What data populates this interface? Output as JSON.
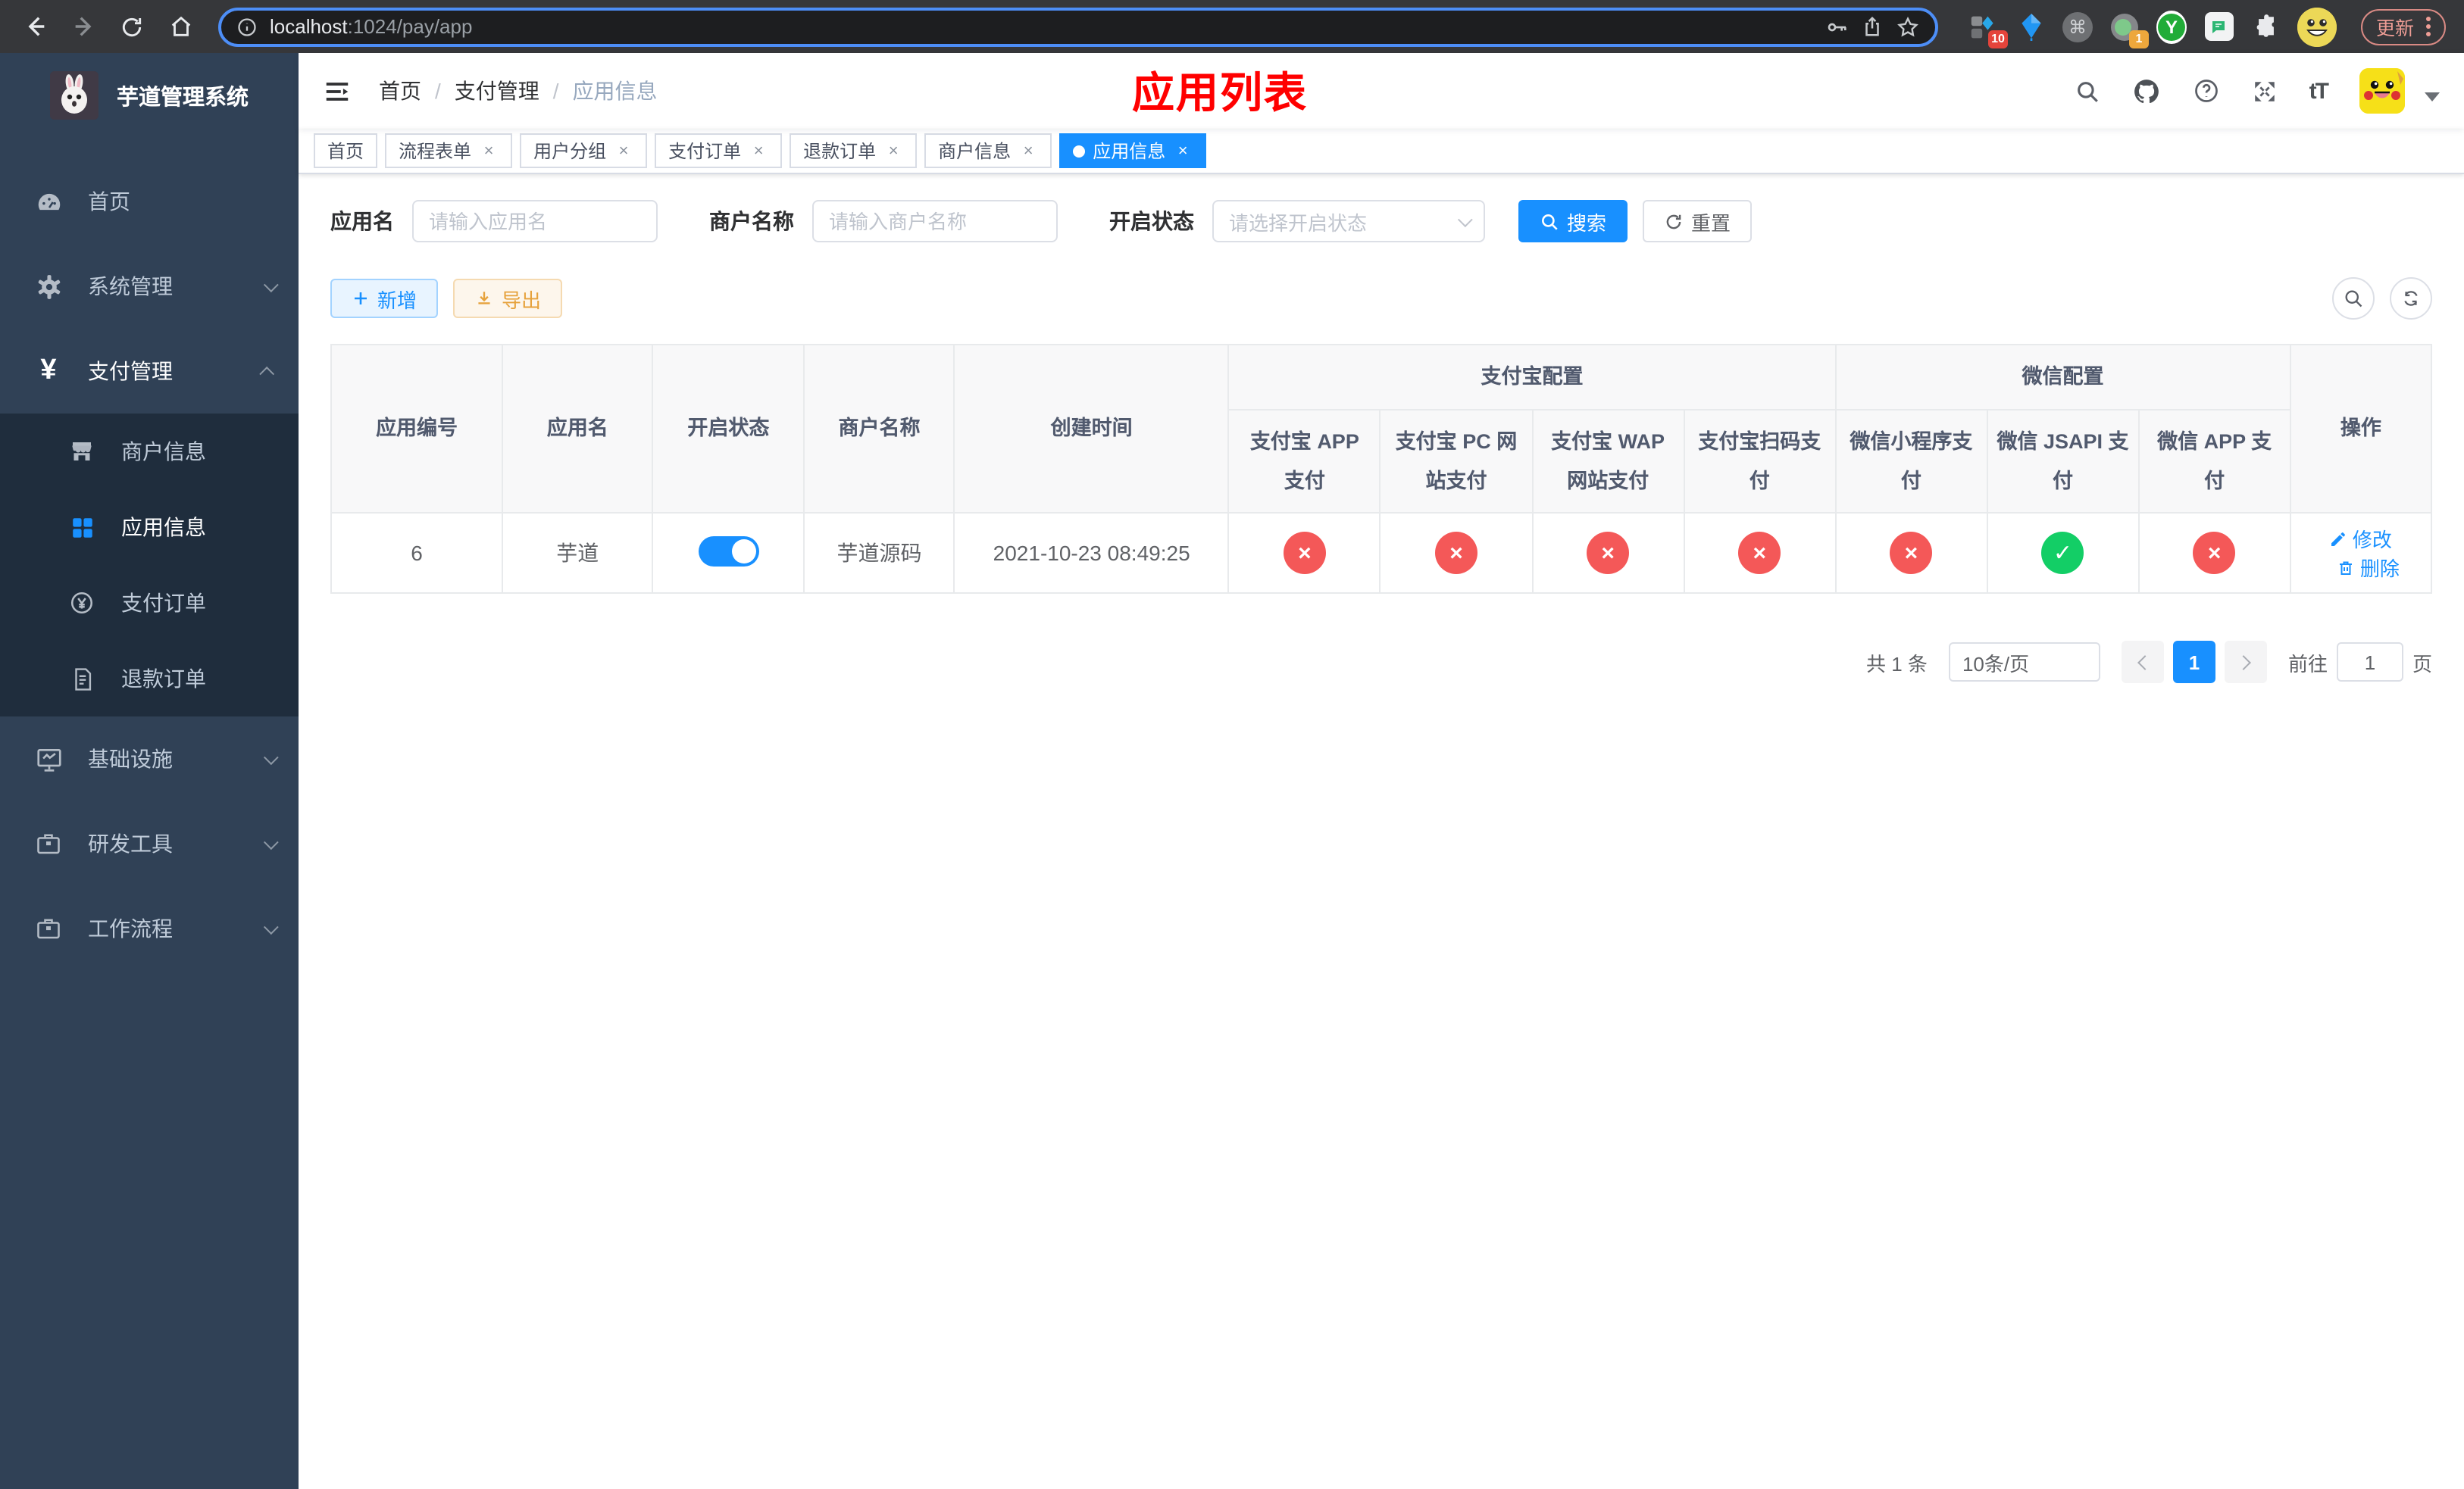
{
  "browser": {
    "url_host": "localhost",
    "url_path": ":1024/pay/app",
    "update_label": "更新",
    "ext_badge_pin": "10",
    "ext_badge_tag": "1",
    "ext_y_label": "Y"
  },
  "glyphs": {
    "yen": "¥",
    "check": "✓",
    "cross": "×",
    "question": "?",
    "command": "⌘",
    "font_size": "tT",
    "close": "×"
  },
  "sidebar": {
    "logo_title": "芋道管理系统",
    "items": [
      {
        "label": "首页",
        "icon": "dashboard"
      },
      {
        "label": "系统管理",
        "icon": "gear"
      },
      {
        "label": "支付管理",
        "icon": "yen"
      }
    ],
    "submenu": [
      {
        "label": "商户信息",
        "icon": "storefront"
      },
      {
        "label": "应用信息",
        "icon": "grid"
      },
      {
        "label": "支付订单",
        "icon": "pay-order"
      },
      {
        "label": "退款订单",
        "icon": "refund-doc"
      }
    ],
    "items_bottom": [
      {
        "label": "基础设施",
        "icon": "monitor-chart"
      },
      {
        "label": "研发工具",
        "icon": "briefcase"
      },
      {
        "label": "工作流程",
        "icon": "briefcase"
      }
    ]
  },
  "header": {
    "breadcrumb": [
      "首页",
      "支付管理",
      "应用信息"
    ],
    "separator": "/",
    "title": "应用列表"
  },
  "tabs": {
    "items": [
      {
        "label": "首页",
        "closable": false,
        "active": false
      },
      {
        "label": "流程表单",
        "closable": true,
        "active": false
      },
      {
        "label": "用户分组",
        "closable": true,
        "active": false
      },
      {
        "label": "支付订单",
        "closable": true,
        "active": false
      },
      {
        "label": "退款订单",
        "closable": true,
        "active": false
      },
      {
        "label": "商户信息",
        "closable": true,
        "active": false
      },
      {
        "label": "应用信息",
        "closable": true,
        "active": true
      }
    ]
  },
  "filters": {
    "app_name_label": "应用名",
    "app_name_placeholder": "请输入应用名",
    "merchant_label": "商户名称",
    "merchant_placeholder": "请输入商户名称",
    "status_label": "开启状态",
    "status_placeholder": "请选择开启状态",
    "search_label": "搜索",
    "reset_label": "重置"
  },
  "toolbar": {
    "add_label": "新增",
    "export_label": "导出"
  },
  "table": {
    "headers": {
      "app_id": "应用编号",
      "app_name": "应用名",
      "status": "开启状态",
      "merchant": "商户名称",
      "created": "创建时间",
      "alipay_group": "支付宝配置",
      "wechat_group": "微信配置",
      "actions": "操作"
    },
    "sub_headers": [
      "支付宝 APP 支付",
      "支付宝 PC 网站支付",
      "支付宝 WAP 网站支付",
      "支付宝扫码支付",
      "微信小程序支付",
      "微信 JSAPI 支付",
      "微信 APP 支付"
    ],
    "row": {
      "app_id": "6",
      "app_name": "芋道",
      "status_on": true,
      "merchant": "芋道源码",
      "created": "2021-10-23 08:49:25",
      "channels": [
        false,
        false,
        false,
        false,
        false,
        true,
        false
      ],
      "edit_label": "修改",
      "delete_label": "删除"
    }
  },
  "pagination": {
    "total": "共 1 条",
    "page_size": "10条/页",
    "page": "1",
    "goto_label": "前往",
    "goto_value": "1",
    "page_unit": "页"
  },
  "colors": {
    "accent": "#1890ff",
    "success": "#13ce66",
    "danger": "#f45858",
    "title_red": "#ff0000",
    "sidebar_bg": "#304156",
    "submenu_bg": "#1f2d3d"
  }
}
